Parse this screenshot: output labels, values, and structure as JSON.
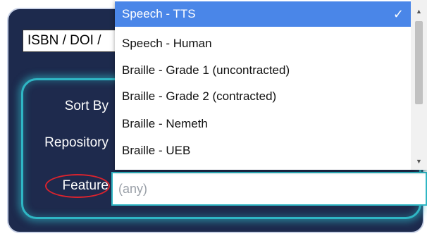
{
  "search": {
    "value": "ISBN / DOI /"
  },
  "filters": {
    "sort_label": "Sort By",
    "repository_label": "Repository",
    "feature_label": "Feature",
    "feature_placeholder": "(any)"
  },
  "dropdown": {
    "options": [
      {
        "label": "Speech - TTS",
        "selected": true
      },
      {
        "label": "Speech - Human"
      },
      {
        "label": "Braille - Grade 1 (uncontracted)"
      },
      {
        "label": "Braille - Grade 2 (contracted)"
      },
      {
        "label": "Braille - Nemeth"
      },
      {
        "label": "Braille - UEB"
      }
    ],
    "check_glyph": "✓"
  },
  "colors": {
    "background": "#1d2a4d",
    "accent": "#2fb6c4",
    "selected": "#4a86e8",
    "highlight_circle": "#d9232e"
  }
}
